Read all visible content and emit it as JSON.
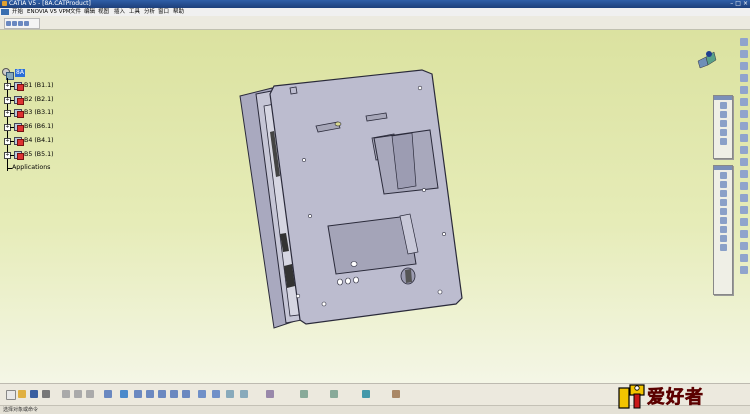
{
  "window": {
    "title": "CATIA V5 - [8A.CATProduct]"
  },
  "menu": {
    "items": [
      "开始",
      "ENOVIA V5 VPM",
      "文件",
      "编辑",
      "视图",
      "插入",
      "工具",
      "分析",
      "窗口",
      "帮助"
    ]
  },
  "tree": {
    "root": "8A",
    "items": [
      {
        "label": "B1 (B1.1)"
      },
      {
        "label": "B2 (B2.1)"
      },
      {
        "label": "B3 (B3.1)"
      },
      {
        "label": "B6 (B6.1)"
      },
      {
        "label": "B4 (B4.1)"
      },
      {
        "label": "B5 (B5.1)"
      }
    ],
    "applications": "Applications",
    "expander": "+"
  },
  "status": {
    "text": "选择对象或命令"
  },
  "watermark": {
    "text": "爱好者"
  },
  "colors": {
    "background": "#dbe2a0",
    "part_face": "#bcbccf",
    "part_edge": "#2a2a3a",
    "tree_selected": "#2a6fd8"
  },
  "icons": [
    "compass-icon",
    "product-icon",
    "part-icon",
    "select-icon",
    "fly-icon",
    "pan-icon",
    "rotate-icon",
    "zoom-in-icon",
    "zoom-out-icon",
    "normal-view-icon",
    "iso-view-icon",
    "shading-icon",
    "hide-show-icon"
  ]
}
